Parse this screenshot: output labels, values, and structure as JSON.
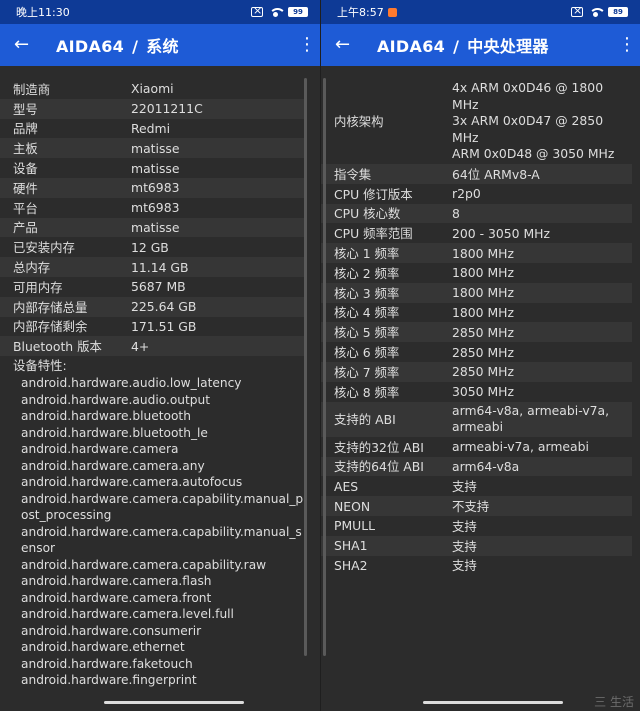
{
  "left": {
    "status": {
      "time": "晚上11:30",
      "battery": "99"
    },
    "appbar": {
      "app": "AIDA64",
      "sep": "/",
      "section": "系统"
    },
    "rows": [
      {
        "k": "制造商",
        "v": "Xiaomi"
      },
      {
        "k": "型号",
        "v": "22011211C"
      },
      {
        "k": "品牌",
        "v": "Redmi"
      },
      {
        "k": "主板",
        "v": "matisse"
      },
      {
        "k": "设备",
        "v": "matisse"
      },
      {
        "k": "硬件",
        "v": "mt6983"
      },
      {
        "k": "平台",
        "v": "mt6983"
      },
      {
        "k": "产品",
        "v": "matisse"
      },
      {
        "k": "已安装内存",
        "v": "12 GB"
      },
      {
        "k": "总内存",
        "v": "11.14 GB"
      },
      {
        "k": "可用内存",
        "v": "5687 MB"
      },
      {
        "k": "内部存储总量",
        "v": "225.64 GB"
      },
      {
        "k": "内部存储剩余",
        "v": "171.51 GB"
      },
      {
        "k": "Bluetooth 版本",
        "v": "4+"
      }
    ],
    "features_title": "设备特性:",
    "features": [
      "android.hardware.audio.low_latency",
      "android.hardware.audio.output",
      "android.hardware.bluetooth",
      "android.hardware.bluetooth_le",
      "android.hardware.camera",
      "android.hardware.camera.any",
      "android.hardware.camera.autofocus",
      "android.hardware.camera.capability.manual_post_processing",
      "android.hardware.camera.capability.manual_sensor",
      "android.hardware.camera.capability.raw",
      "android.hardware.camera.flash",
      "android.hardware.camera.front",
      "android.hardware.camera.level.full",
      "android.hardware.consumerir",
      "android.hardware.ethernet",
      "android.hardware.faketouch",
      "android.hardware.fingerprint"
    ]
  },
  "right": {
    "status": {
      "time": "上午8:57",
      "battery": "89"
    },
    "appbar": {
      "app": "AIDA64",
      "sep": "/",
      "section": "中央处理器"
    },
    "rows": [
      {
        "k": "内核架构",
        "v": "4x ARM 0x0D46 @ 1800 MHz\n3x ARM 0x0D47 @ 2850 MHz\nARM 0x0D48 @ 3050 MHz",
        "multi": true
      },
      {
        "k": "指令集",
        "v": "64位 ARMv8-A"
      },
      {
        "k": "CPU 修订版本",
        "v": "r2p0"
      },
      {
        "k": "CPU 核心数",
        "v": "8"
      },
      {
        "k": "CPU 频率范围",
        "v": "200 - 3050 MHz"
      },
      {
        "k": "核心 1 频率",
        "v": "1800 MHz"
      },
      {
        "k": "核心 2 频率",
        "v": "1800 MHz"
      },
      {
        "k": "核心 3 频率",
        "v": "1800 MHz"
      },
      {
        "k": "核心 4 频率",
        "v": "1800 MHz"
      },
      {
        "k": "核心 5 频率",
        "v": "2850 MHz"
      },
      {
        "k": "核心 6 频率",
        "v": "2850 MHz"
      },
      {
        "k": "核心 7 频率",
        "v": "2850 MHz"
      },
      {
        "k": "核心 8 频率",
        "v": "3050 MHz"
      },
      {
        "k": "支持的 ABI",
        "v": "arm64-v8a, armeabi-v7a,\narmeabi",
        "multi": true
      },
      {
        "k": "支持的32位 ABI",
        "v": "armeabi-v7a, armeabi"
      },
      {
        "k": "支持的64位 ABI",
        "v": "arm64-v8a"
      },
      {
        "k": "AES",
        "v": "支持"
      },
      {
        "k": "NEON",
        "v": "不支持"
      },
      {
        "k": "PMULL",
        "v": "支持"
      },
      {
        "k": "SHA1",
        "v": "支持"
      },
      {
        "k": "SHA2",
        "v": "支持"
      }
    ]
  },
  "watermark": "三 生活",
  "icons": {
    "back": "arrow-back-icon",
    "more": "more-vert-icon"
  },
  "colors": {
    "statusbar": "#0e3a96",
    "appbar": "#1e5bd6",
    "background": "#2c2c2c",
    "stripe": "#363636",
    "text": "#dedede"
  }
}
